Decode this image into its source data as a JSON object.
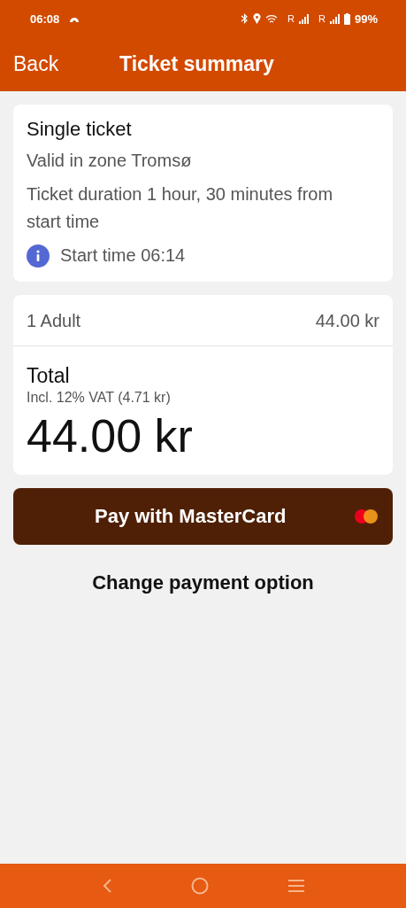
{
  "status_bar": {
    "time": "06:08",
    "network_labels": [
      "R",
      "R"
    ],
    "battery": "99%"
  },
  "header": {
    "back": "Back",
    "title": "Ticket summary"
  },
  "ticket": {
    "name": "Single ticket",
    "zone": "Valid in zone Tromsø",
    "duration": "Ticket duration 1 hour, 30 minutes from start time",
    "start_time": "Start time 06:14"
  },
  "price": {
    "lines": [
      {
        "label": "1 Adult",
        "amount": "44.00 kr"
      }
    ],
    "total_label": "Total",
    "vat": "Incl. 12% VAT (4.71 kr)",
    "total": "44.00 kr"
  },
  "pay_button": "Pay with MasterCard",
  "change_option": "Change payment option"
}
